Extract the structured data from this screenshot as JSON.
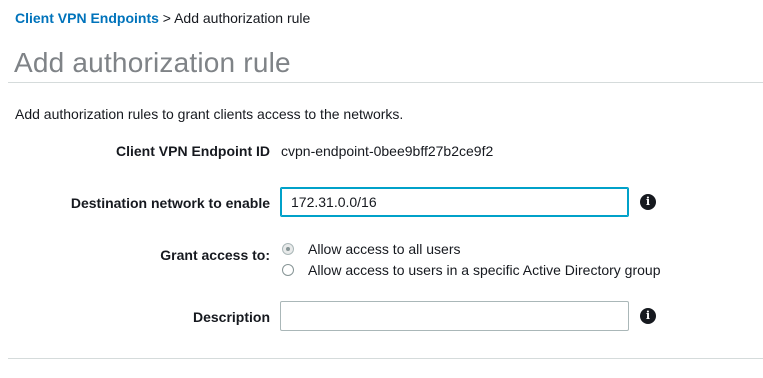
{
  "breadcrumb": {
    "parent": "Client VPN Endpoints",
    "separator": ">",
    "current": "Add authorization rule"
  },
  "page": {
    "title": "Add authorization rule",
    "intro": "Add authorization rules to grant clients access to the networks."
  },
  "form": {
    "endpoint_id_label": "Client VPN Endpoint ID",
    "endpoint_id_value": "cvpn-endpoint-0bee9bff27b2ce9f2",
    "destination_label": "Destination network to enable",
    "destination_value": "172.31.0.0/16",
    "grant_access_label": "Grant access to:",
    "grant_options": [
      {
        "label": "Allow access to all users",
        "selected": true
      },
      {
        "label": "Allow access to users in a specific Active Directory group",
        "selected": false
      }
    ],
    "description_label": "Description",
    "description_value": "",
    "info_icon_glyph": "i"
  }
}
